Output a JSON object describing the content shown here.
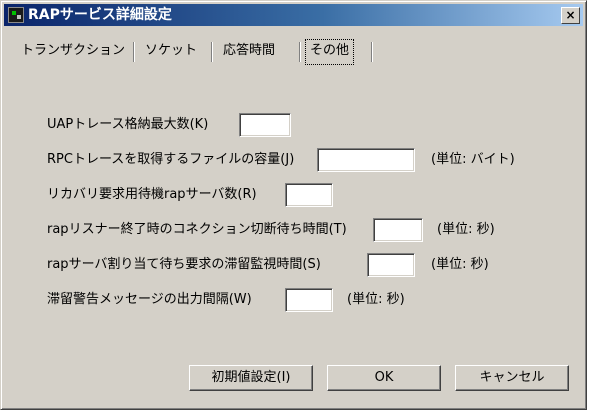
{
  "window": {
    "title": "RAPサービス詳細設定",
    "close_label": "×"
  },
  "tabs": [
    {
      "label": "トランザクション",
      "active": false
    },
    {
      "label": "ソケット",
      "active": false
    },
    {
      "label": "応答時間",
      "active": false
    },
    {
      "label": "その他",
      "active": true
    }
  ],
  "settings": {
    "uap_trace": {
      "label": "UAPトレース格納最大数(K)",
      "value": ""
    },
    "rpc_trace_size": {
      "label": "RPCトレースを取得するファイルの容量(J)",
      "value": "",
      "unit": "(単位: バイト)"
    },
    "recovery_servers": {
      "label": "リカバリ要求用待機rapサーバ数(R)",
      "value": ""
    },
    "listener_disconnect_wait": {
      "label": "rapリスナー終了時のコネクション切断待ち時間(T)",
      "value": "",
      "unit": "(単位: 秒)"
    },
    "queue_monitor_time": {
      "label": "rapサーバ割り当て待ち要求の滞留監視時間(S)",
      "value": "",
      "unit": "(単位: 秒)"
    },
    "warning_interval": {
      "label": "滞留警告メッセージの出力間隔(W)",
      "value": "",
      "unit": "(単位: 秒)"
    }
  },
  "buttons": {
    "defaults": "初期値設定(I)",
    "ok": "OK",
    "cancel": "キャンセル"
  },
  "icons": {
    "app": "app-icon",
    "close": "close-icon"
  }
}
